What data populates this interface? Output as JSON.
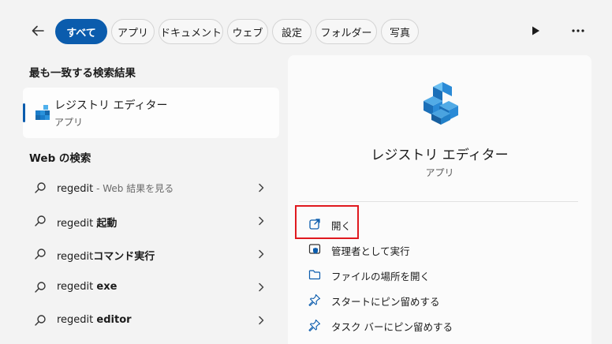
{
  "filters": {
    "tabs": [
      {
        "label": "すべて",
        "active": true
      },
      {
        "label": "アプリ"
      },
      {
        "label": "ドキュメント"
      },
      {
        "label": "ウェブ"
      },
      {
        "label": "設定"
      },
      {
        "label": "フォルダー"
      },
      {
        "label": "写真"
      }
    ]
  },
  "left": {
    "best_match_title": "最も一致する検索結果",
    "best_match": {
      "name": "レジストリ エディター",
      "type": "アプリ"
    },
    "web_title": "Web の検索",
    "web_results": [
      {
        "main": "regedit",
        "suffix": "",
        "sub": " - Web 結果を見る"
      },
      {
        "main": "regedit ",
        "suffix": "起動",
        "sub": ""
      },
      {
        "main": "regedit",
        "suffix": "コマンド実行",
        "sub": ""
      },
      {
        "main": "regedit ",
        "suffix": "exe",
        "sub": ""
      },
      {
        "main": "regedit ",
        "suffix": "editor",
        "sub": ""
      }
    ]
  },
  "right": {
    "app_name": "レジストリ エディター",
    "app_type": "アプリ",
    "actions": [
      {
        "label": "開く",
        "icon": "open-external-icon"
      },
      {
        "label": "管理者として実行",
        "icon": "shield-admin-icon"
      },
      {
        "label": "ファイルの場所を開く",
        "icon": "folder-icon"
      },
      {
        "label": "スタートにピン留めする",
        "icon": "pin-icon"
      },
      {
        "label": "タスク バーにピン留めする",
        "icon": "pin-icon"
      }
    ]
  },
  "colors": {
    "accent": "#0b5cad",
    "highlight": "#e0191f"
  }
}
